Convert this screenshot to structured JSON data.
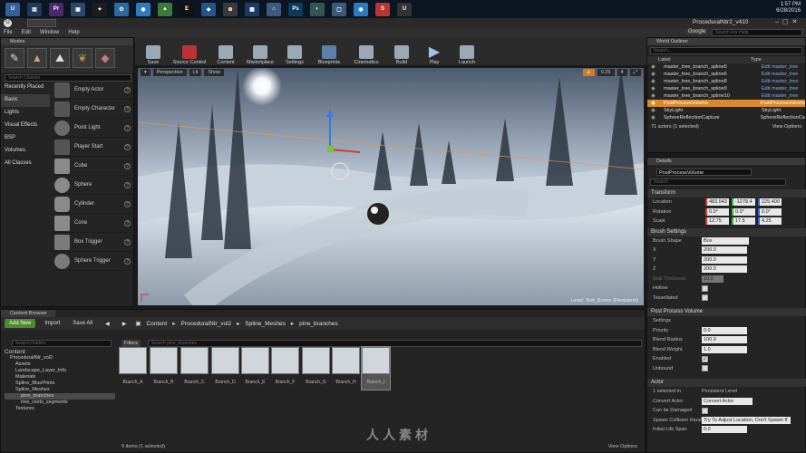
{
  "taskbar": {
    "icons": [
      "explorer-icon",
      "photoshop-icon",
      "premiere-icon",
      "browser-icon",
      "app-icon",
      "app-icon",
      "chrome-icon",
      "app-icon",
      "epic-icon",
      "app-icon",
      "app-icon",
      "app-icon",
      "app-icon",
      "photoshop-icon",
      "app-icon",
      "app-icon",
      "chrome-icon",
      "app-icon",
      "unreal-icon"
    ],
    "time": "1:57 PM",
    "date": "6/28/2016"
  },
  "window": {
    "title": "ProceduralNtr2_v410",
    "search_placeholder": "Search For Help",
    "google_label": "Google"
  },
  "menu": [
    "File",
    "Edit",
    "Window",
    "Help"
  ],
  "modes": {
    "tab": "Modes",
    "search_placeholder": "Search Classes",
    "categories": [
      "Recently Placed",
      "Basic",
      "Lights",
      "Visual Effects",
      "BSP",
      "Volumes",
      "All Classes"
    ],
    "items": [
      "Empty Actor",
      "Empty Character",
      "Point Light",
      "Player Start",
      "Cube",
      "Sphere",
      "Cylinder",
      "Cone",
      "Box Trigger",
      "Sphere Trigger"
    ]
  },
  "toolbar": [
    "Save",
    "Source Control",
    "Content",
    "Marketplace",
    "Settings",
    "Blueprints",
    "Cinematics",
    "Build",
    "Play",
    "Launch"
  ],
  "viewport": {
    "perspective": "Perspective",
    "lit": "Lit",
    "show": "Show",
    "snap_angle": "0.25",
    "cam_speed": "4",
    "level_label": "Level:  Test_Scene (Persistent)"
  },
  "outliner": {
    "tab": "World Outliner",
    "search_placeholder": "Search...",
    "col_label": "Label",
    "col_type": "Type",
    "rows": [
      {
        "label": "master_tree_branch_spline5",
        "type": "Edit master_tree"
      },
      {
        "label": "master_tree_branch_spline6",
        "type": "Edit master_tree"
      },
      {
        "label": "master_tree_branch_spline8",
        "type": "Edit master_tree"
      },
      {
        "label": "master_tree_branch_spline9",
        "type": "Edit master_tree"
      },
      {
        "label": "master_tree_branch_spline10",
        "type": "Edit master_tree"
      },
      {
        "label": "PostProcessVolume",
        "type": "PostProcessVolume"
      },
      {
        "label": "SkyLight",
        "type": "SkyLight"
      },
      {
        "label": "SphereReflectionCapture",
        "type": "SphereReflectionCapture"
      }
    ],
    "footer": "71 actors (1 selected)",
    "view_options": "View Options"
  },
  "details": {
    "tab": "Details",
    "name": "PostProcessVolume",
    "search_placeholder": "Search",
    "transform": "Transform",
    "location_label": "Location",
    "rotation_label": "Rotation",
    "scale_label": "Scale",
    "location": [
      "483.643",
      "-1278.4",
      "225.400"
    ],
    "rotation": [
      "0.0°",
      "0.0°",
      "0.0°"
    ],
    "scale": [
      "12.75",
      "17.5",
      "4.25"
    ],
    "brush_settings": "Brush Settings",
    "brush_shape_label": "Brush Shape",
    "brush_shape": "Box",
    "x_label": "X",
    "y_label": "Y",
    "z_label": "Z",
    "x": "200.0",
    "y": "200.0",
    "z": "200.0",
    "wall_thickness_label": "Wall Thickness",
    "wall_thickness": "10.0",
    "hollow_label": "Hollow",
    "tessellated_label": "Tessellated",
    "ppv": "Post Process Volume",
    "settings_label": "Settings",
    "priority_label": "Priority",
    "priority": "0.0",
    "blend_radius_label": "Blend Radius",
    "blend_radius": "100.0",
    "blend_weight_label": "Blend Weight",
    "blend_weight": "1.0",
    "enabled_label": "Enabled",
    "unbound_label": "Unbound",
    "actor": "Actor",
    "selected_label": "1 selected in",
    "selected_value": "Persistent Level",
    "convert_label": "Convert Actor",
    "convert_value": "Convert Actor",
    "can_damaged_label": "Can be Damaged",
    "spawn_label": "Spawn Collision Hand",
    "spawn_value": "Try To Adjust Location, Don't Spawn If",
    "life_label": "Initial Life Span",
    "life_value": "0.0"
  },
  "content_browser": {
    "tab": "Content Browser",
    "add_new": "Add New",
    "import": "Import",
    "save_all": "Save All",
    "crumbs": [
      "Content",
      "ProceduralNtr_vol2",
      "Spline_Meshes",
      "pine_branches"
    ],
    "search_folders": "Search Folders",
    "filters": "Filters",
    "search_assets": "Search pine_branches",
    "tree": [
      "Content",
      "ProceduralNtr_vol2",
      "Assets",
      "Landscape_Layer_Info",
      "Materials",
      "Spline_BluePrints",
      "Spline_Meshes",
      "pine_branches",
      "tree_roots_segments",
      "Textures"
    ],
    "assets": [
      "Branch_A",
      "Branch_B",
      "Branch_C",
      "Branch_D",
      "Branch_E",
      "Branch_F",
      "Branch_G",
      "Branch_H",
      "Branch_I"
    ],
    "footer": "9 items (1 selected)",
    "view_options": "View Options"
  },
  "watermark": "人人素材"
}
